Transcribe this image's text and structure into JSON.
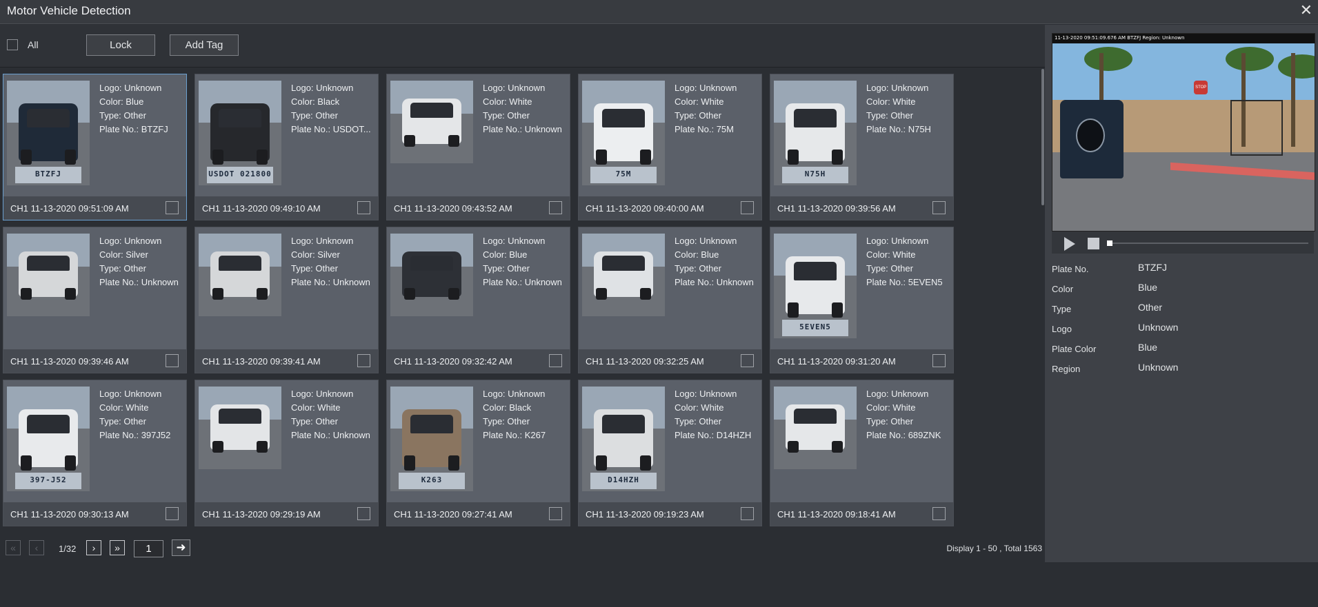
{
  "window": {
    "title": "Motor Vehicle Detection"
  },
  "toolbar": {
    "all_label": "All",
    "lock_label": "Lock",
    "add_tag_label": "Add Tag"
  },
  "labels": {
    "logo": "Logo: ",
    "color": "Color: ",
    "type": "Type: ",
    "plate": "Plate No.: "
  },
  "cards": [
    {
      "logo": "Unknown",
      "color": "Blue",
      "type": "Other",
      "plate": "BTZFJ",
      "timestamp": "CH1 11-13-2020 09:51:09 AM",
      "thumb_plate": "BTZFJ",
      "car_color": "#1f2a38",
      "selected": true
    },
    {
      "logo": "Unknown",
      "color": "Black",
      "type": "Other",
      "plate": "USDOT...",
      "timestamp": "CH1 11-13-2020 09:49:10 AM",
      "thumb_plate": "USDOT 021800",
      "car_color": "#26282c",
      "selected": false
    },
    {
      "logo": "Unknown",
      "color": "White",
      "type": "Other",
      "plate": "Unknown",
      "timestamp": "CH1 11-13-2020 09:43:52 AM",
      "thumb_plate": "",
      "car_color": "#e4e6e8",
      "selected": false
    },
    {
      "logo": "Unknown",
      "color": "White",
      "type": "Other",
      "plate": "75M",
      "timestamp": "CH1 11-13-2020 09:40:00 AM",
      "thumb_plate": "75M",
      "car_color": "#eceef0",
      "selected": false
    },
    {
      "logo": "Unknown",
      "color": "White",
      "type": "Other",
      "plate": "N75H",
      "timestamp": "CH1 11-13-2020 09:39:56 AM",
      "thumb_plate": "N75H",
      "car_color": "#e6e8ea",
      "selected": false
    },
    {
      "logo": "Unknown",
      "color": "Silver",
      "type": "Other",
      "plate": "Unknown",
      "timestamp": "CH1 11-13-2020 09:39:46 AM",
      "thumb_plate": "",
      "car_color": "#d5d7d9",
      "selected": false
    },
    {
      "logo": "Unknown",
      "color": "Silver",
      "type": "Other",
      "plate": "Unknown",
      "timestamp": "CH1 11-13-2020 09:39:41 AM",
      "thumb_plate": "",
      "car_color": "#d5d7d9",
      "selected": false
    },
    {
      "logo": "Unknown",
      "color": "Blue",
      "type": "Other",
      "plate": "Unknown",
      "timestamp": "CH1 11-13-2020 09:32:42 AM",
      "thumb_plate": "",
      "car_color": "#2d3036",
      "selected": false
    },
    {
      "logo": "Unknown",
      "color": "Blue",
      "type": "Other",
      "plate": "Unknown",
      "timestamp": "CH1 11-13-2020 09:32:25 AM",
      "thumb_plate": "",
      "car_color": "#dfe2e5",
      "selected": false
    },
    {
      "logo": "Unknown",
      "color": "White",
      "type": "Other",
      "plate": "5EVEN5",
      "timestamp": "CH1 11-13-2020 09:31:20 AM",
      "thumb_plate": "5EVEN5",
      "car_color": "#e7e9eb",
      "selected": false
    },
    {
      "logo": "Unknown",
      "color": "White",
      "type": "Other",
      "plate": "397J52",
      "timestamp": "CH1 11-13-2020 09:30:13 AM",
      "thumb_plate": "397-J52",
      "car_color": "#e8eaec",
      "selected": false
    },
    {
      "logo": "Unknown",
      "color": "White",
      "type": "Other",
      "plate": "Unknown",
      "timestamp": "CH1 11-13-2020 09:29:19 AM",
      "thumb_plate": "",
      "car_color": "#e3e5e7",
      "selected": false
    },
    {
      "logo": "Unknown",
      "color": "Black",
      "type": "Other",
      "plate": "K267",
      "timestamp": "CH1 11-13-2020 09:27:41 AM",
      "thumb_plate": "K263",
      "car_color": "#8a7560",
      "selected": false
    },
    {
      "logo": "Unknown",
      "color": "White",
      "type": "Other",
      "plate": "D14HZH",
      "timestamp": "CH1 11-13-2020 09:19:23 AM",
      "thumb_plate": "D14HZH",
      "car_color": "#dcdee0",
      "selected": false
    },
    {
      "logo": "Unknown",
      "color": "White",
      "type": "Other",
      "plate": "689ZNK",
      "timestamp": "CH1 11-13-2020 09:18:41 AM",
      "thumb_plate": "",
      "car_color": "#e5e7e9",
      "selected": false
    }
  ],
  "pager": {
    "page_indicator": "1/32",
    "current_page": "1",
    "display_text": "Display 1 - 50 , Total 1563",
    "first_icon": "first-page-icon",
    "prev_icon": "prev-page-icon",
    "next_icon": "next-page-icon",
    "last_icon": "last-page-icon",
    "go_icon": "arrow-right-icon"
  },
  "preview": {
    "overlay_text": "11-13-2020 09:51:09.676 AM BTZFJ Region: Unknown",
    "stop_sign_text": "STOP"
  },
  "details": [
    {
      "label": "Plate No.",
      "value": "BTZFJ"
    },
    {
      "label": "Color",
      "value": "Blue"
    },
    {
      "label": "Type",
      "value": "Other"
    },
    {
      "label": "Logo",
      "value": "Unknown"
    },
    {
      "label": "Plate Color",
      "value": "Blue"
    },
    {
      "label": "Region",
      "value": "Unknown"
    }
  ],
  "colors": {
    "accent_selected": "#6aa0d0",
    "card_bg": "#5b6069",
    "panel_bg": "#3e4147"
  }
}
